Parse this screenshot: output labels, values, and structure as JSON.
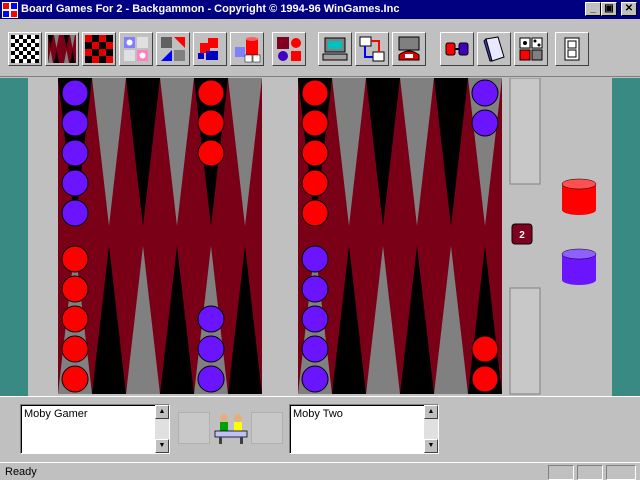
{
  "window": {
    "title": "Board Games For 2 - Backgammon - Copyright © 1994-96 WinGames.Inc",
    "controls": {
      "minimize": "_",
      "maximize": "▣",
      "close": "✕"
    }
  },
  "toolbar": {
    "buttons": [
      {
        "icon": "checkers-board-icon"
      },
      {
        "icon": "backgammon-board-icon"
      },
      {
        "icon": "red-checkers-board-icon"
      },
      {
        "icon": "pieces-set-icon"
      },
      {
        "icon": "shapes-icon"
      },
      {
        "icon": "puzzle-icon"
      },
      {
        "icon": "dice-cup-icon"
      },
      {
        "icon": "colored-pieces-icon"
      },
      {
        "icon": "computer-icon"
      },
      {
        "icon": "network-icon"
      },
      {
        "icon": "phone-icon"
      },
      {
        "icon": "connect-icon"
      },
      {
        "icon": "book-icon"
      },
      {
        "icon": "dice-set-icon"
      },
      {
        "icon": "door-exit-icon"
      }
    ]
  },
  "board": {
    "colors": {
      "felt": "#7a0018",
      "dark_point": "#000000",
      "light_point": "#808080",
      "frame": "#c0c0c0",
      "red_checker": "#ff0000",
      "blue_checker": "#6a14ff",
      "teal": "#3a8a84"
    },
    "points": [
      {
        "point": 13,
        "color": "blue",
        "count": 5
      },
      {
        "point": 17,
        "color": "red",
        "count": 3
      },
      {
        "point": 19,
        "color": "red",
        "count": 5
      },
      {
        "point": 24,
        "color": "blue",
        "count": 2
      },
      {
        "point": 12,
        "color": "red",
        "count": 5
      },
      {
        "point": 8,
        "color": "blue",
        "count": 3
      },
      {
        "point": 6,
        "color": "blue",
        "count": 5
      },
      {
        "point": 1,
        "color": "red",
        "count": 2
      }
    ],
    "die_value": "2"
  },
  "players": {
    "left": {
      "name": "Moby Gamer"
    },
    "right": {
      "name": "Moby Two"
    }
  },
  "status": {
    "text": "Ready"
  }
}
